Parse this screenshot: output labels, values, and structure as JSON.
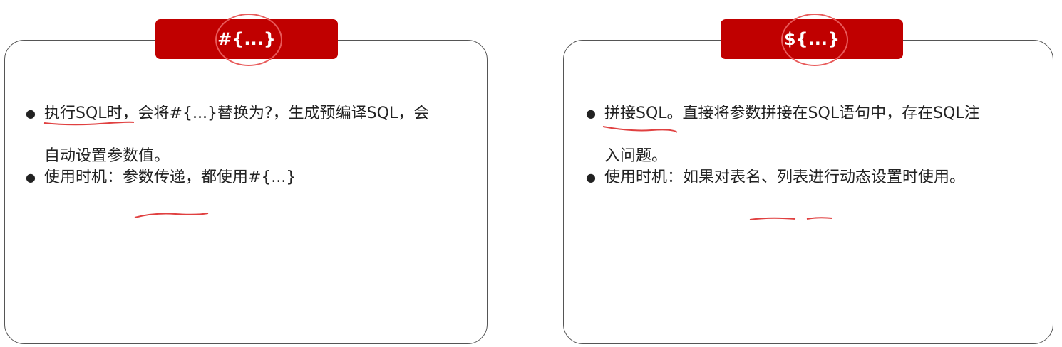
{
  "left_card": {
    "tag": "#{...}",
    "items": [
      {
        "line1": "执行SQL时，会将#{...}替换为?，生成预编译SQL，会",
        "line2": "自动设置参数值。"
      },
      {
        "line1": "使用时机：参数传递，都使用#{...}"
      }
    ]
  },
  "right_card": {
    "tag": "${...}",
    "items": [
      {
        "line1": "拼接SQL。直接将参数拼接在SQL语句中，存在SQL注",
        "line2": "入问题。"
      },
      {
        "line1": "使用时机：如果对表名、列表进行动态设置时使用。"
      }
    ]
  },
  "bullet": "●",
  "colors": {
    "accent": "#c00000",
    "annotation": "#e04040",
    "border": "#555555"
  }
}
